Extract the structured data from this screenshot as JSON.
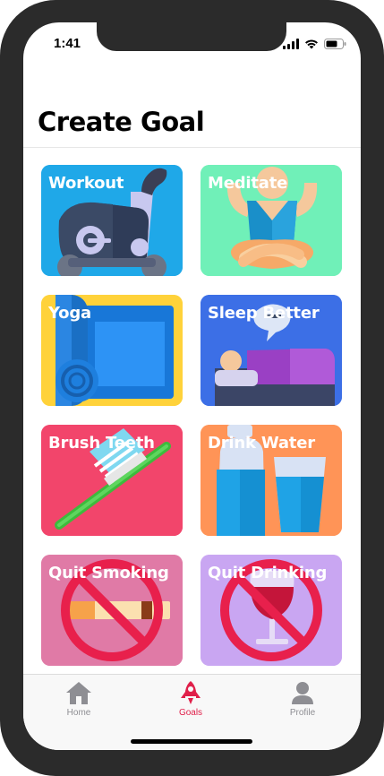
{
  "status": {
    "time": "1:41"
  },
  "page": {
    "title": "Create Goal"
  },
  "goals": [
    {
      "label": "Workout",
      "icon": "exercise-bike-icon",
      "color": "#1fa8e8"
    },
    {
      "label": "Meditate",
      "icon": "meditation-icon",
      "color": "#70f0b8"
    },
    {
      "label": "Yoga",
      "icon": "yoga-mat-icon",
      "color": "#ffd23a"
    },
    {
      "label": "Sleep Better",
      "icon": "sleeping-person-icon",
      "color": "#3c6fe6"
    },
    {
      "label": "Brush Teeth",
      "icon": "toothbrush-icon",
      "color": "#f2456b"
    },
    {
      "label": "Drink Water",
      "icon": "water-bottle-glass-icon",
      "color": "#ff9457"
    },
    {
      "label": "Quit Smoking",
      "icon": "no-smoking-icon",
      "color": "#e07aa6"
    },
    {
      "label": "Quit Drinking",
      "icon": "no-drinking-icon",
      "color": "#c9a6f2"
    }
  ],
  "tabs": [
    {
      "label": "Home",
      "icon": "home-icon",
      "active": false
    },
    {
      "label": "Goals",
      "icon": "rocket-icon",
      "active": true
    },
    {
      "label": "Profile",
      "icon": "person-icon",
      "active": false
    }
  ],
  "colors": {
    "accent": "#e0204a",
    "inactive": "#8e8e93"
  }
}
